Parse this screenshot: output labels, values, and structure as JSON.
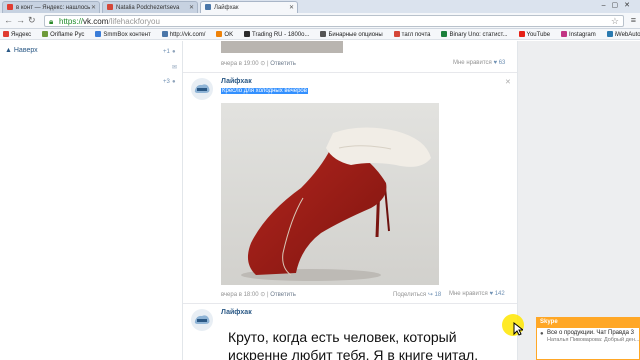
{
  "tabs": [
    {
      "label": "в конт — Яндекс: нашлось",
      "icon": "yandex-icon",
      "color": "#e03c31"
    },
    {
      "label": "Natalia Podchezertseva",
      "icon": "gmail-icon",
      "color": "#d44638"
    },
    {
      "label": "Лайфхак",
      "icon": "vk-icon",
      "color": "#4a76a8"
    }
  ],
  "address": {
    "scheme": "https://",
    "host": "vk.com",
    "path": "/lifehackforyou"
  },
  "bookmarks": [
    {
      "label": "Яндекс",
      "color": "#e03c31"
    },
    {
      "label": "Oriflame Рус",
      "color": "#6e9a3a"
    },
    {
      "label": "SmmBox контент",
      "color": "#3b7dd8"
    },
    {
      "label": "http://vk.com/",
      "color": "#4a76a8"
    },
    {
      "label": "OK",
      "color": "#ee8208"
    },
    {
      "label": "Trading RU - 1800о...",
      "color": "#2c2c2c"
    },
    {
      "label": "Бинарные опционы",
      "color": "#555555"
    },
    {
      "label": "тагл почта",
      "color": "#d44638"
    },
    {
      "label": "Binary Uno: статист...",
      "color": "#1b7f3b"
    },
    {
      "label": "YouTube",
      "color": "#e62117"
    },
    {
      "label": "Instagram",
      "color": "#c13584"
    },
    {
      "label": "iWebAutomatic",
      "color": "#2a7ab0"
    }
  ],
  "sidebar": {
    "back_label": "Наверх",
    "counter_top": "+1",
    "counter_mid": "+3"
  },
  "posts": [
    {
      "time": "вчера в 19:00",
      "action": "Ответить",
      "like_label": "Мне нравится",
      "like_count": "63"
    },
    {
      "author": "Лайфхак",
      "selected_text": "Кресло для холодных вечеров",
      "time": "вчера в 18:00",
      "action": "Ответить",
      "share_label": "Поделиться",
      "share_count": "18",
      "like_label": "Мне нравится",
      "like_count": "142"
    },
    {
      "author": "Лайфхак",
      "text": "Круто, когда есть человек, который искренне любит тебя. Я в книге читал."
    }
  ],
  "skype": {
    "header": "Skype",
    "line1": "Все о продукции. Чат Правда 3",
    "line2": "Наталья Пивоварова: Добрый ден..."
  },
  "colors": {
    "vk_link": "#2a5885",
    "selection": "#3390ff",
    "skype_accent": "#ffa726",
    "cursor_highlight": "#ffe600"
  }
}
